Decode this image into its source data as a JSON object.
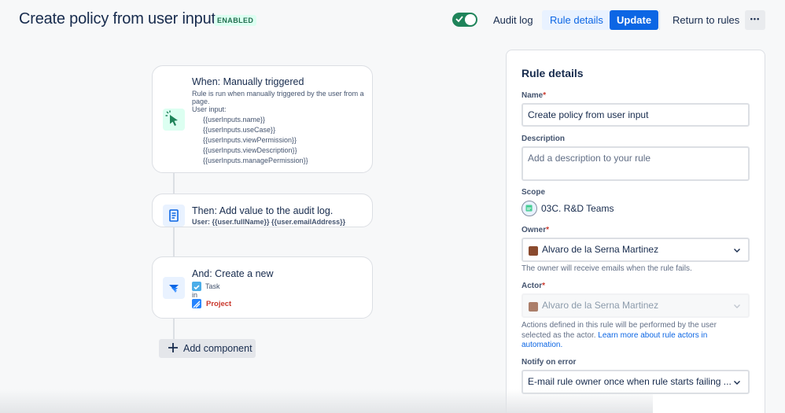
{
  "header": {
    "title": "Create policy from user input",
    "status": "ENABLED",
    "toggle_on": true,
    "audit_log": "Audit log",
    "rule_details": "Rule details",
    "update": "Update",
    "return": "Return to rules",
    "more": "•••"
  },
  "canvas": {
    "trigger": {
      "title": "When: Manually triggered",
      "description": "Rule is run when manually triggered by the user from a page.",
      "inputs_label": "User input:",
      "inputs": [
        "{{userInputs.name}}",
        "{{userInputs.useCase}}",
        "{{userInputs.viewPermission}}",
        "{{userInputs.viewDescription}}",
        "{{userInputs.managePermission}}"
      ]
    },
    "audit": {
      "title": "Then: Add value to the audit log.",
      "subtitle": "User: {{user.fullName}} {{user.emailAddress}}"
    },
    "create": {
      "title": "And: Create a new",
      "issue_type": "Task",
      "in_label": "in",
      "project": "Project"
    },
    "add_component": "Add component"
  },
  "panel": {
    "title": "Rule details",
    "name_label": "Name",
    "name_value": "Create policy from user input",
    "description_label": "Description",
    "description_placeholder": "Add a description to your rule",
    "scope_label": "Scope",
    "scope_value": "03C. R&D Teams",
    "owner_label": "Owner",
    "owner_value": "Alvaro de la Serna Martinez",
    "owner_help": "The owner will receive emails when the rule fails.",
    "actor_label": "Actor",
    "actor_value": "Alvaro de la Serna Martinez",
    "actor_help": "Actions defined in this rule will be performed by the user selected as the actor.",
    "actor_link": "Learn more about rule actors in automation.",
    "notify_label": "Notify on error",
    "notify_value": "E-mail rule owner once when rule starts failing ..."
  },
  "colors": {
    "brand_blue": "#0c66e4",
    "success_green": "#1f845a",
    "required_red": "#c9372c"
  }
}
